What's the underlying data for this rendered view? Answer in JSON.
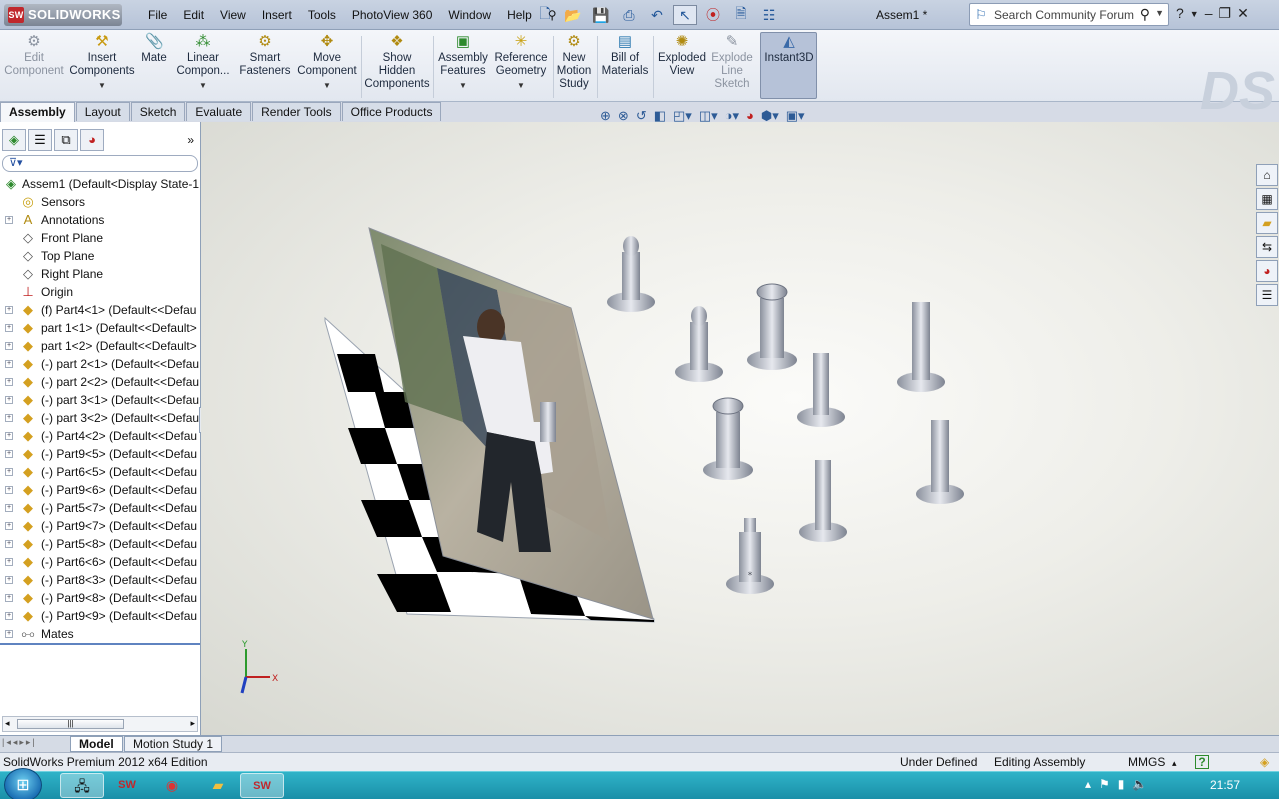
{
  "titlebar": {
    "brand": "SOLIDWORKS",
    "menu": [
      "File",
      "Edit",
      "View",
      "Insert",
      "Tools",
      "PhotoView 360",
      "Window",
      "Help"
    ],
    "doc_title": "Assem1 *",
    "search_placeholder": "Search Community Forum"
  },
  "commands": [
    {
      "label": "Edit Component",
      "icon": "edit-component-icon",
      "enabled": false
    },
    {
      "label": "Insert Components",
      "icon": "insert-components-icon",
      "enabled": true
    },
    {
      "label": "Mate",
      "icon": "mate-icon",
      "enabled": true
    },
    {
      "label": "Linear Compon...",
      "icon": "linear-pattern-icon",
      "enabled": true
    },
    {
      "label": "Smart Fasteners",
      "icon": "smart-fasteners-icon",
      "enabled": true
    },
    {
      "label": "Move Component",
      "icon": "move-component-icon",
      "enabled": true
    },
    {
      "label": "Show Hidden Components",
      "icon": "show-hidden-icon",
      "enabled": true
    },
    {
      "label": "Assembly Features",
      "icon": "assembly-features-icon",
      "enabled": true
    },
    {
      "label": "Reference Geometry",
      "icon": "reference-geometry-icon",
      "enabled": true
    },
    {
      "label": "New Motion Study",
      "icon": "motion-study-icon",
      "enabled": true
    },
    {
      "label": "Bill of Materials",
      "icon": "bom-icon",
      "enabled": true
    },
    {
      "label": "Exploded View",
      "icon": "exploded-view-icon",
      "enabled": true
    },
    {
      "label": "Explode Line Sketch",
      "icon": "explode-line-icon",
      "enabled": false
    },
    {
      "label": "Instant3D",
      "icon": "instant3d-icon",
      "enabled": true
    }
  ],
  "tabs": [
    "Assembly",
    "Layout",
    "Sketch",
    "Evaluate",
    "Render Tools",
    "Office Products"
  ],
  "tree": {
    "root": "Assem1  (Default<Display State-1",
    "items": [
      {
        "label": "Sensors",
        "icon": "sensor-icon",
        "expand": false
      },
      {
        "label": "Annotations",
        "icon": "annotation-icon",
        "expand": true
      },
      {
        "label": "Front Plane",
        "icon": "plane-icon",
        "expand": false
      },
      {
        "label": "Top Plane",
        "icon": "plane-icon",
        "expand": false
      },
      {
        "label": "Right Plane",
        "icon": "plane-icon",
        "expand": false
      },
      {
        "label": "Origin",
        "icon": "origin-icon",
        "expand": false
      },
      {
        "label": "(f) Part4<1> (Default<<Defau",
        "icon": "part-icon",
        "expand": true
      },
      {
        "label": "part 1<1> (Default<<Default>",
        "icon": "part-icon",
        "expand": true
      },
      {
        "label": "part 1<2> (Default<<Default>",
        "icon": "part-icon",
        "expand": true
      },
      {
        "label": "(-) part 2<1> (Default<<Defau",
        "icon": "part-icon",
        "expand": true
      },
      {
        "label": "(-) part 2<2> (Default<<Defau",
        "icon": "part-icon",
        "expand": true
      },
      {
        "label": "(-) part 3<1> (Default<<Defau",
        "icon": "part-icon",
        "expand": true
      },
      {
        "label": "(-) part 3<2> (Default<<Defau",
        "icon": "part-icon",
        "expand": true
      },
      {
        "label": "(-) Part4<2> (Default<<Defau",
        "icon": "part-icon",
        "expand": true
      },
      {
        "label": "(-) Part9<5> (Default<<Defau",
        "icon": "part-icon",
        "expand": true
      },
      {
        "label": "(-) Part6<5> (Default<<Defau",
        "icon": "part-icon",
        "expand": true
      },
      {
        "label": "(-) Part9<6> (Default<<Defau",
        "icon": "part-icon",
        "expand": true
      },
      {
        "label": "(-) Part5<7> (Default<<Defau",
        "icon": "part-icon",
        "expand": true
      },
      {
        "label": "(-) Part9<7> (Default<<Defau",
        "icon": "part-icon",
        "expand": true
      },
      {
        "label": "(-) Part5<8> (Default<<Defau",
        "icon": "part-icon",
        "expand": true
      },
      {
        "label": "(-) Part6<6> (Default<<Defau",
        "icon": "part-icon",
        "expand": true
      },
      {
        "label": "(-) Part8<3> (Default<<Defau",
        "icon": "part-icon",
        "expand": true
      },
      {
        "label": "(-) Part9<8> (Default<<Defau",
        "icon": "part-icon",
        "expand": true
      },
      {
        "label": "(-) Part9<9> (Default<<Defau",
        "icon": "part-icon",
        "expand": true
      },
      {
        "label": "Mates",
        "icon": "mates-icon",
        "expand": true
      }
    ]
  },
  "triad": {
    "x": "X",
    "y": "Y"
  },
  "bottom_tabs": [
    "Model",
    "Motion Study 1"
  ],
  "status": {
    "product": "SolidWorks Premium 2012 x64 Edition",
    "state": "Under Defined",
    "mode": "Editing Assembly",
    "units": "MMGS"
  },
  "taskbar": {
    "clock": "21:57"
  },
  "colors": {
    "accent": "#2d5b96",
    "taskbar": "#1a8fa8",
    "brand_red": "#c0282d"
  }
}
